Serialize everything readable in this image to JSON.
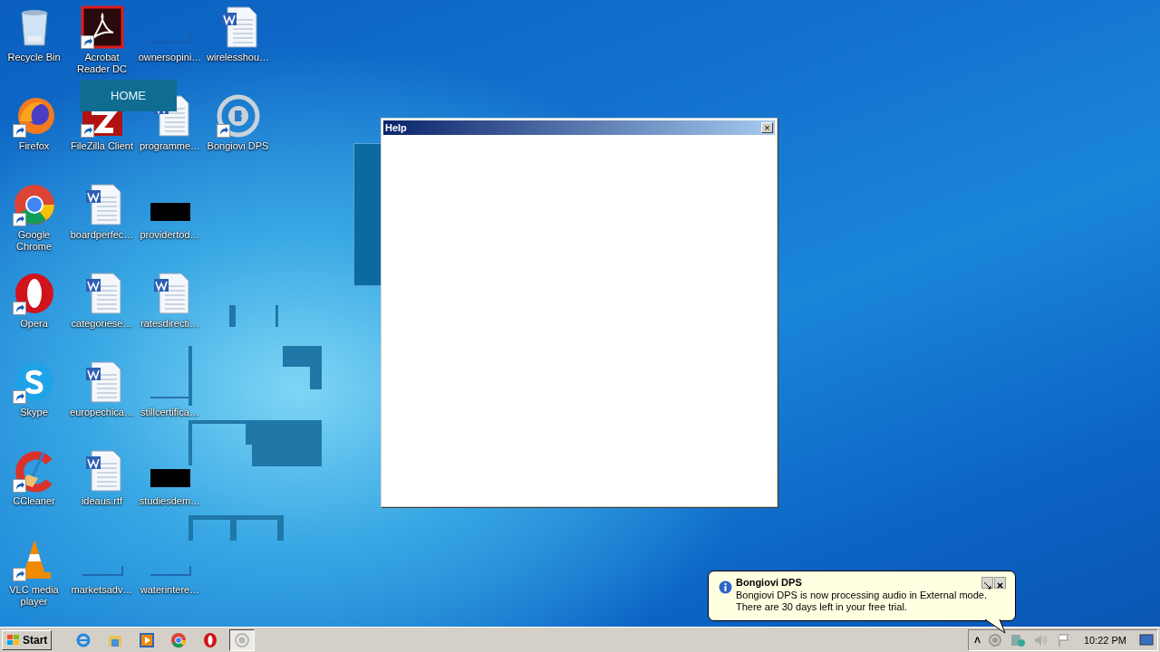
{
  "desktop_icons": [
    {
      "label": "Recycle Bin",
      "kind": "recycle",
      "shortcut": false
    },
    {
      "label": "Firefox",
      "kind": "firefox",
      "shortcut": true
    },
    {
      "label": "Google Chrome",
      "kind": "chrome",
      "shortcut": true
    },
    {
      "label": "Opera",
      "kind": "opera",
      "shortcut": true
    },
    {
      "label": "Skype",
      "kind": "skype",
      "shortcut": true
    },
    {
      "label": "CCleaner",
      "kind": "ccleaner",
      "shortcut": true
    },
    {
      "label": "VLC media player",
      "kind": "vlc",
      "shortcut": true
    },
    {
      "label": "Acrobat Reader DC",
      "kind": "pdf",
      "shortcut": true
    },
    {
      "label": "FileZilla Client",
      "kind": "filezilla",
      "shortcut": true
    },
    {
      "label": "boardperfec…",
      "kind": "word",
      "shortcut": false
    },
    {
      "label": "categoriese…",
      "kind": "word",
      "shortcut": false
    },
    {
      "label": "europechica…",
      "kind": "word",
      "shortcut": false
    },
    {
      "label": "ideaus.rtf",
      "kind": "word",
      "shortcut": false
    },
    {
      "label": "marketsadv…",
      "kind": "blank",
      "shortcut": false
    },
    {
      "label": "ownersopini…",
      "kind": "blank",
      "shortcut": false
    },
    {
      "label": "programme…",
      "kind": "word",
      "shortcut": false
    },
    {
      "label": "providertod…",
      "kind": "black",
      "shortcut": false
    },
    {
      "label": "ratesdirecti…",
      "kind": "word",
      "shortcut": false
    },
    {
      "label": "stillcertifica…",
      "kind": "blank",
      "shortcut": false
    },
    {
      "label": "studiesdem…",
      "kind": "black",
      "shortcut": false
    },
    {
      "label": "waterintere…",
      "kind": "blank",
      "shortcut": false
    },
    {
      "label": "wirelesshou…",
      "kind": "word",
      "shortcut": false
    },
    {
      "label": "Bongiovi DPS",
      "kind": "bongiovi",
      "shortcut": true
    }
  ],
  "home_banner": {
    "label": "HOME"
  },
  "help_window": {
    "title": "Help",
    "close": "×"
  },
  "notification": {
    "title": "Bongiovi DPS",
    "message": "Bongiovi DPS is now processing audio in External mode. There are 30 days left in your free trial."
  },
  "taskbar": {
    "start_label": "Start",
    "pinned": [
      {
        "kind": "ie",
        "selected": false
      },
      {
        "kind": "folder",
        "selected": false
      },
      {
        "kind": "media",
        "selected": false
      },
      {
        "kind": "chrome",
        "selected": false
      },
      {
        "kind": "opera",
        "selected": false
      },
      {
        "kind": "bongiovi",
        "selected": true
      }
    ],
    "tray": {
      "chevron": "˄",
      "clock": "10:22 PM"
    }
  }
}
